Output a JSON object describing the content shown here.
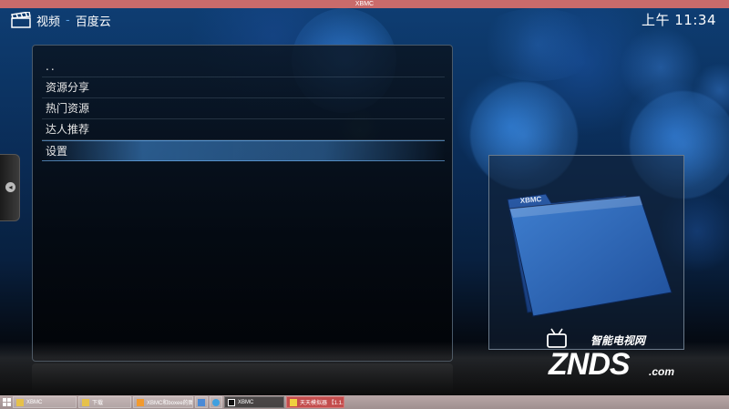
{
  "window": {
    "title": "XBMC"
  },
  "header": {
    "section": "视频",
    "separator": "-",
    "location": "百度云",
    "clock": "上午 11:34"
  },
  "list": {
    "items": [
      {
        "label": "..",
        "focused": false
      },
      {
        "label": "资源分享",
        "focused": false
      },
      {
        "label": "热门资源",
        "focused": false
      },
      {
        "label": "达人推荐",
        "focused": false
      },
      {
        "label": "设置",
        "focused": true
      }
    ]
  },
  "thumbnail": {
    "folder_label": "XBMC",
    "icon": "folder-icon"
  },
  "watermark": {
    "cn": "智能电视网",
    "en": "ZNDS",
    "suffix": ".com"
  },
  "taskbar": {
    "items": [
      {
        "label": "XBMC"
      },
      {
        "label": "下载"
      },
      {
        "label": "XBMC和boxee的图..."
      },
      {
        "label": ""
      },
      {
        "label": ""
      },
      {
        "label": "XBMC"
      },
      {
        "label": "天天模拟器 【1.1.10..."
      }
    ]
  },
  "colors": {
    "accent": "#3a86d8",
    "titlebar": "#c96b6b",
    "taskbar": "#ad9b9b"
  }
}
